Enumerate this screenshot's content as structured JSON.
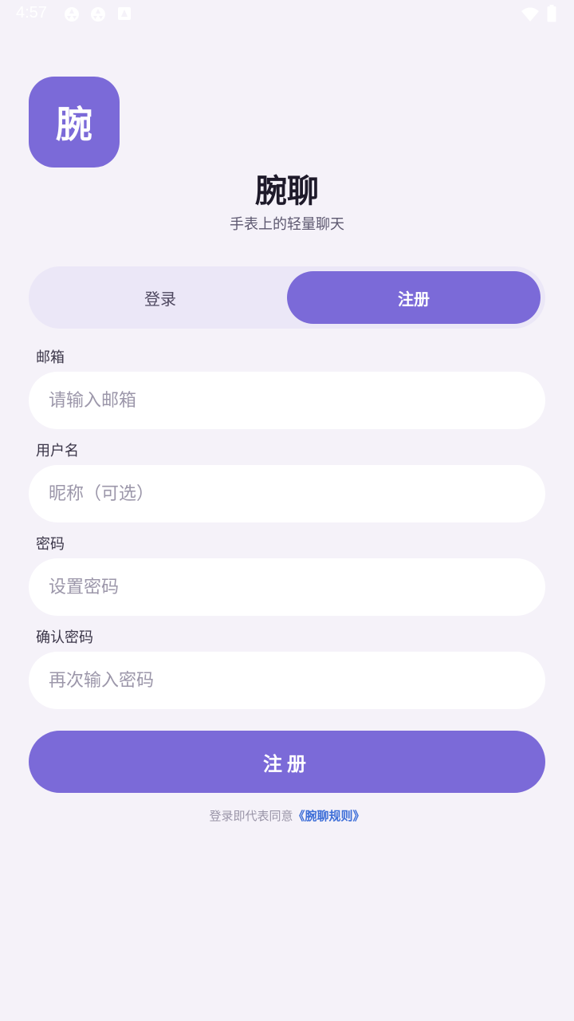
{
  "status_bar": {
    "time": "4:57",
    "icons": [
      "aperture-icon",
      "aperture-icon",
      "keyboard-icon",
      "wifi-icon",
      "battery-icon"
    ]
  },
  "app": {
    "logo_text": "腕",
    "title": "腕聊",
    "subtitle": "手表上的轻量聊天"
  },
  "tabs": {
    "login": "登录",
    "register": "注册",
    "active": "register"
  },
  "form": {
    "email": {
      "label": "邮箱",
      "placeholder": "请输入邮箱",
      "value": ""
    },
    "username": {
      "label": "用户名",
      "placeholder": "昵称（可选）",
      "value": ""
    },
    "password": {
      "label": "密码",
      "placeholder": "设置密码",
      "value": ""
    },
    "confirm_password": {
      "label": "确认密码",
      "placeholder": "再次输入密码",
      "value": ""
    }
  },
  "submit_label": "注册",
  "agreement": {
    "prefix": "登录即代表同意",
    "link": "《腕聊规则》"
  },
  "colors": {
    "background": "#f5f2f9",
    "accent": "#7b6ad8",
    "segment_bg": "#ebe7f7",
    "link": "#3e6fd8"
  }
}
